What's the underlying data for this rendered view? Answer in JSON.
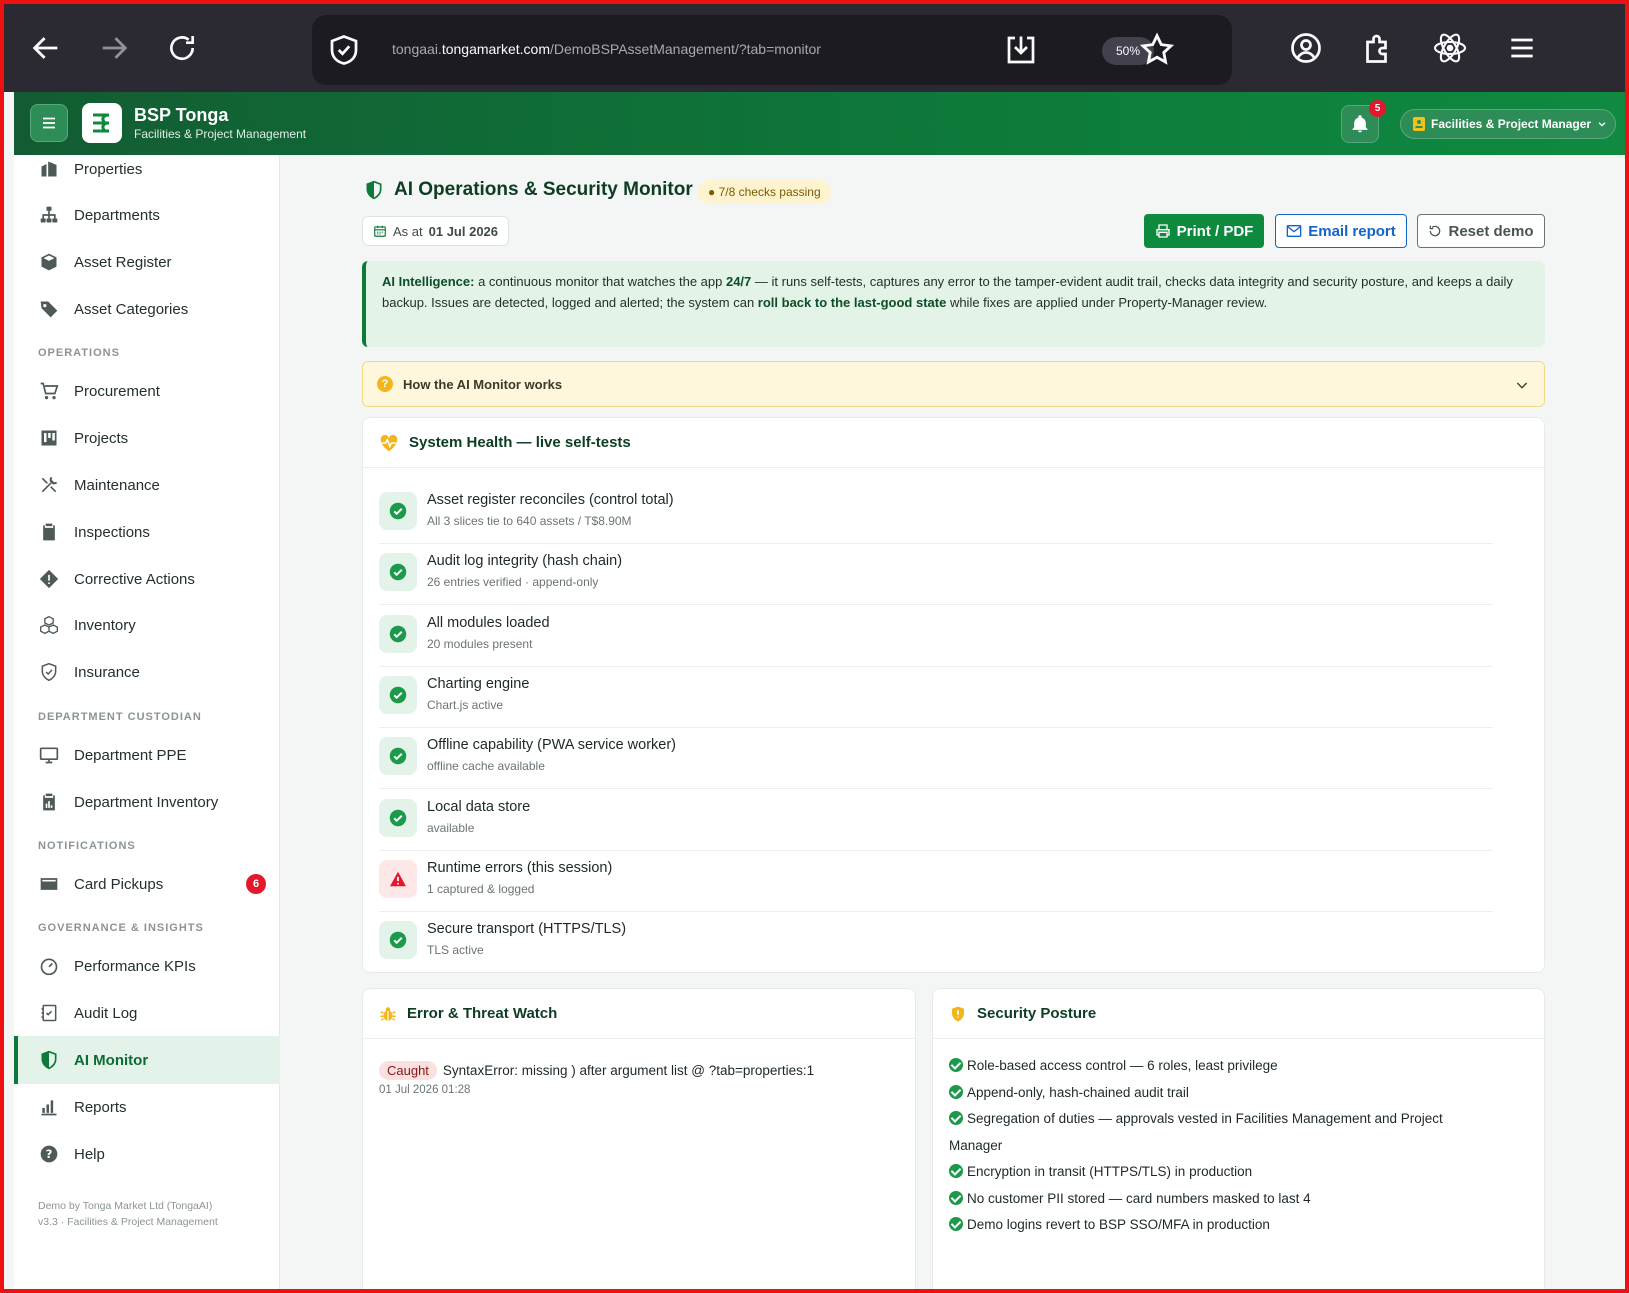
{
  "browser": {
    "url_prefix": "tongaai.",
    "url_domain": "tongamarket.com",
    "url_path": "/DemoBSPAssetManagement/?tab=monitor",
    "zoom": "50%"
  },
  "header": {
    "brand_title": "BSP Tonga",
    "brand_sub": "Facilities & Project Management",
    "notif_count": "5",
    "role": "Facilities & Project Manager"
  },
  "sidebar": {
    "items_top": [
      {
        "label": "Properties",
        "icon": "building-icon"
      },
      {
        "label": "Departments",
        "icon": "org-chart-icon"
      },
      {
        "label": "Asset Register",
        "icon": "box-icon"
      },
      {
        "label": "Asset Categories",
        "icon": "tag-icon"
      }
    ],
    "section_operations": "OPERATIONS",
    "items_operations": [
      {
        "label": "Procurement",
        "icon": "cart-icon"
      },
      {
        "label": "Projects",
        "icon": "kanban-icon"
      },
      {
        "label": "Maintenance",
        "icon": "tools-icon"
      },
      {
        "label": "Inspections",
        "icon": "clipboard-icon"
      },
      {
        "label": "Corrective Actions",
        "icon": "diamond-alert-icon"
      },
      {
        "label": "Inventory",
        "icon": "boxes-icon"
      },
      {
        "label": "Insurance",
        "icon": "shield-check-icon"
      }
    ],
    "section_custodian": "DEPARTMENT CUSTODIAN",
    "items_custodian": [
      {
        "label": "Department PPE",
        "icon": "monitor-icon"
      },
      {
        "label": "Department Inventory",
        "icon": "clipboard-data-icon"
      }
    ],
    "section_notifications": "NOTIFICATIONS",
    "card_pickups": {
      "label": "Card Pickups",
      "badge": "6",
      "icon": "card-icon"
    },
    "section_governance": "GOVERNANCE & INSIGHTS",
    "items_governance": [
      {
        "label": "Performance KPIs",
        "icon": "speedometer-icon"
      },
      {
        "label": "Audit Log",
        "icon": "journal-check-icon"
      },
      {
        "label": "AI Monitor",
        "icon": "shield-half-icon"
      },
      {
        "label": "Reports",
        "icon": "bar-chart-icon"
      },
      {
        "label": "Help",
        "icon": "question-circle-icon"
      }
    ],
    "footer_line1": "Demo by Tonga Market Ltd (TongaAI)",
    "footer_line2": "v3.3 · Facilities & Project Management"
  },
  "main": {
    "title": "AI Operations & Security Monitor",
    "checks_passing": "● 7/8 checks passing",
    "as_at_label": "As at",
    "as_at_date": "01 Jul 2026",
    "btn_print": "Print / PDF",
    "btn_email": "Email report",
    "btn_reset": "Reset demo",
    "ai_note": {
      "lead": "AI Intelligence:",
      "t1": " a continuous monitor that watches the app ",
      "b1": "24/7",
      "t2": " — it runs self-tests, captures any error to the tamper-evident audit trail, checks data integrity and security posture, and keeps a daily backup. Issues are detected, logged and alerted; the system can ",
      "b2": "roll back to the last-good state",
      "t3": " while fixes are applied under Property-Manager review."
    },
    "how_label": "How the AI Monitor works",
    "health_title": "System Health — live self-tests",
    "checks": [
      {
        "title": "Asset register reconciles (control total)",
        "detail": "All 3 slices tie to 640 assets / T$8.90M",
        "status": "pass"
      },
      {
        "title": "Audit log integrity (hash chain)",
        "detail": "26 entries verified · append-only",
        "status": "pass"
      },
      {
        "title": "All modules loaded",
        "detail": "20 modules present",
        "status": "pass"
      },
      {
        "title": "Charting engine",
        "detail": "Chart.js active",
        "status": "pass"
      },
      {
        "title": "Offline capability (PWA service worker)",
        "detail": "offline cache available",
        "status": "pass"
      },
      {
        "title": "Local data store",
        "detail": "available",
        "status": "pass"
      },
      {
        "title": "Runtime errors (this session)",
        "detail": "1 captured & logged",
        "status": "warn"
      },
      {
        "title": "Secure transport (HTTPS/TLS)",
        "detail": "TLS active",
        "status": "pass"
      }
    ],
    "threat_title": "Error & Threat Watch",
    "threat_entry": {
      "tag": "Caught",
      "message": "SyntaxError: missing ) after argument list @ ?tab=properties:1",
      "time": "01 Jul 2026 01:28"
    },
    "security_title": "Security Posture",
    "security_items": [
      "Role-based access control — 6 roles, least privilege",
      "Append-only, hash-chained audit trail",
      "Segregation of duties — approvals vested in Facilities Management and Project Manager",
      "Encryption in transit (HTTPS/TLS) in production",
      "No customer PII stored — card numbers masked to last 4",
      "Demo logins revert to BSP SSO/MFA in production"
    ]
  },
  "colors": {
    "brand_green": "#0d7a3a",
    "pass_green": "#1a9a4a",
    "warn_red": "#e3182d",
    "accent_blue": "#1264c8"
  }
}
